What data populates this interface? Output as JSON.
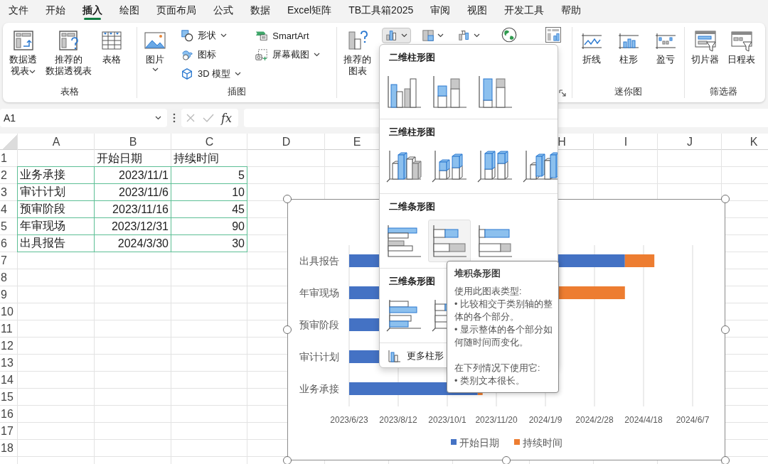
{
  "menu_tabs": [
    {
      "label": "文件",
      "selected": false
    },
    {
      "label": "开始",
      "selected": false
    },
    {
      "label": "插入",
      "selected": true
    },
    {
      "label": "绘图",
      "selected": false
    },
    {
      "label": "页面布局",
      "selected": false
    },
    {
      "label": "公式",
      "selected": false
    },
    {
      "label": "数据",
      "selected": false
    },
    {
      "label": "Excel矩阵",
      "selected": false
    },
    {
      "label": "TB工具箱2025",
      "selected": false
    },
    {
      "label": "审阅",
      "selected": false
    },
    {
      "label": "视图",
      "selected": false
    },
    {
      "label": "开发工具",
      "selected": false
    },
    {
      "label": "帮助",
      "selected": false
    }
  ],
  "ribbon": {
    "groups": [
      {
        "label": "表格",
        "items": [
          {
            "kind": "large",
            "label": "数据透视表",
            "dropdown": true
          },
          {
            "kind": "large",
            "label": "推荐的数据透视表",
            "dropdown": false
          },
          {
            "kind": "large",
            "label": "表格",
            "dropdown": false
          }
        ]
      },
      {
        "label": "插图",
        "items": [
          {
            "kind": "large",
            "label": "图片",
            "dropdown": true
          },
          {
            "kind": "small",
            "label": "形状",
            "dropdown": true
          },
          {
            "kind": "small",
            "label": "图标",
            "dropdown": false
          },
          {
            "kind": "small",
            "label": "3D 模型",
            "dropdown": true
          },
          {
            "kind": "small",
            "label": "SmartArt",
            "dropdown": false
          },
          {
            "kind": "small",
            "label": "屏幕截图",
            "dropdown": true
          }
        ]
      },
      {
        "launcher": true,
        "items": [
          {
            "kind": "large",
            "label": "推荐的图表",
            "dropdown": false
          },
          {
            "kind": "icon",
            "dropdown": true,
            "expanded": true
          },
          {
            "kind": "icon",
            "dropdown": true,
            "expanded": false
          },
          {
            "kind": "icon",
            "dropdown": true,
            "expanded": false
          },
          {
            "kind": "large",
            "dropdown": false
          },
          {
            "kind": "large",
            "dropdown": false
          }
        ]
      },
      {
        "label": "迷你图",
        "items": [
          {
            "kind": "large",
            "label": "折线",
            "dropdown": false
          },
          {
            "kind": "large",
            "label": "柱形",
            "dropdown": false
          },
          {
            "kind": "large",
            "label": "盈亏",
            "dropdown": false
          }
        ]
      },
      {
        "label": "筛选器",
        "items": [
          {
            "kind": "large",
            "label": "切片器",
            "dropdown": false
          },
          {
            "kind": "large",
            "label": "日程表",
            "dropdown": false
          }
        ]
      }
    ]
  },
  "formula_bar": {
    "name_box": "A1",
    "function_button": "fx"
  },
  "sheet": {
    "columns": [
      {
        "label": "A"
      },
      {
        "label": "B"
      },
      {
        "label": "C"
      },
      {
        "label": "D"
      },
      {
        "label": "E"
      },
      {
        "label": "H"
      },
      {
        "label": "I"
      },
      {
        "label": "J"
      },
      {
        "label": "K"
      }
    ],
    "row_numbers": [
      "1",
      "2",
      "3",
      "4",
      "5",
      "6",
      "7",
      "8",
      "9",
      "10",
      "11",
      "12",
      "13",
      "14",
      "15",
      "16",
      "17",
      "18"
    ],
    "header_row": [
      "开始日期",
      "持续时间"
    ],
    "rows": [
      {
        "name": "业务承接",
        "start": "2023/11/1",
        "duration": "5"
      },
      {
        "name": "审计计划",
        "start": "2023/11/6",
        "duration": "10"
      },
      {
        "name": "预审阶段",
        "start": "2023/11/16",
        "duration": "45"
      },
      {
        "name": "年审现场",
        "start": "2023/12/31",
        "duration": "90"
      },
      {
        "name": "出具报告",
        "start": "2024/3/30",
        "duration": "30"
      }
    ]
  },
  "chart": {
    "selected": true,
    "categories": [
      "出具报告",
      "年审现场",
      "预审阶段",
      "审计计划",
      "业务承接"
    ],
    "axis_labels": [
      "2023/6/23",
      "2023/8/12",
      "2023/10/1",
      "2023/11/20",
      "2024/1/9",
      "2024/2/28",
      "2024/4/18",
      "2024/6/7"
    ],
    "legend": [
      {
        "name": "开始日期",
        "color": "#4472c4"
      },
      {
        "name": "持续时间",
        "color": "#ed7d31"
      }
    ]
  },
  "chart_menu": {
    "sections": [
      {
        "title": "二维柱形图",
        "items": [
          {
            "hovered": false
          },
          {
            "hovered": false
          },
          {
            "hovered": false
          }
        ]
      },
      {
        "title": "三维柱形图",
        "items": [
          {
            "hovered": false
          },
          {
            "hovered": false
          },
          {
            "hovered": false
          },
          {
            "hovered": false
          }
        ]
      },
      {
        "title": "二维条形图",
        "items": [
          {
            "hovered": false
          },
          {
            "hovered": true
          },
          {
            "hovered": false
          }
        ]
      },
      {
        "title": "三维条形图",
        "items": [
          {
            "hovered": false
          },
          {
            "hovered": false
          }
        ]
      }
    ],
    "footer": "更多柱形"
  },
  "tooltip": {
    "title": "堆积条形图",
    "sections": [
      [
        "使用此图表类型:",
        "• 比较相交于类别轴的整体的各个部分。",
        "• 显示整体的各个部分如何随时间而变化。"
      ],
      [
        "在下列情况下使用它:",
        "• 类别文本很长。"
      ]
    ]
  }
}
